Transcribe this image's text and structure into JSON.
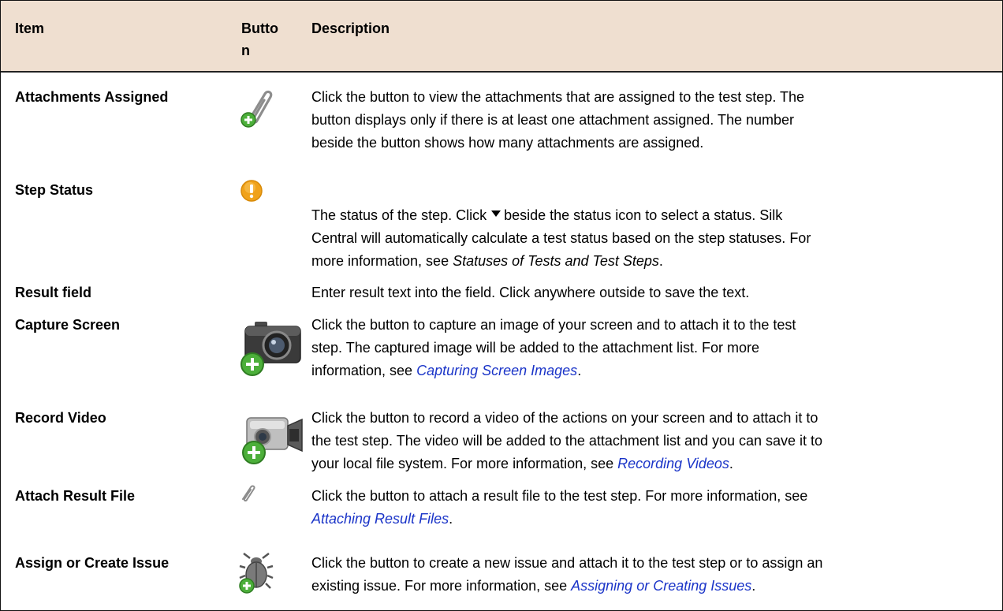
{
  "header": {
    "item": "Item",
    "button_line1": "Butto",
    "button_line2": "n",
    "description": "Description"
  },
  "rows": [
    {
      "item": "Attachments Assigned",
      "icon": "paperclip-add-icon",
      "lines": [
        "Click the button to view the attachments that are assigned to the test step. The",
        "button displays only if there is at least one attachment assigned. The number",
        "beside the button shows how many attachments are assigned."
      ]
    },
    {
      "item": "Step Status",
      "icon": "warning-status-icon",
      "line1_a": "The status of the step. Click",
      "line1_b": "beside the status icon to select a status. Silk",
      "line2": "Central will automatically calculate a test status based on the step statuses. For",
      "line3_a": "more information, see ",
      "line3_ref": "Statuses of Tests and Test Steps",
      "line3_c": "."
    },
    {
      "item": "Result field",
      "lines": [
        "Enter result text into the field. Click anywhere outside to save the text."
      ]
    },
    {
      "item": "Capture Screen",
      "icon": "camera-add-icon",
      "lines": [
        "Click the button to capture an image of your screen and to attach it to the test",
        "step. The captured image will be added to the attachment list. For more"
      ],
      "last_a": "information, see ",
      "link": "Capturing Screen Images",
      "last_c": "."
    },
    {
      "item": "Record Video",
      "icon": "video-camera-add-icon",
      "lines": [
        "Click the button to record a video of the actions on your screen and to attach it to",
        "the test step. The video will be added to the attachment list and you can save it to"
      ],
      "last_a": "your local file system. For more information, see ",
      "link": "Recording Videos",
      "last_c": "."
    },
    {
      "item": "Attach Result File",
      "icon": "paperclip-icon",
      "lines": [
        "Click the button to attach a result file to the test step. For more information, see"
      ],
      "last_a": "",
      "link": "Attaching Result Files",
      "last_c": "."
    },
    {
      "item": "Assign or Create Issue",
      "icon": "bug-add-icon",
      "lines": [
        "Click the button to create a new issue and attach it to the test step or to assign an"
      ],
      "last_a": "existing issue. For more information, see ",
      "link": "Assigning or Creating Issues",
      "last_c": "."
    }
  ],
  "colors": {
    "header_bg": "#efdfd0",
    "link": "#1a34c8",
    "add_badge": "#4caf3a",
    "status_badge": "#f0a21a"
  }
}
